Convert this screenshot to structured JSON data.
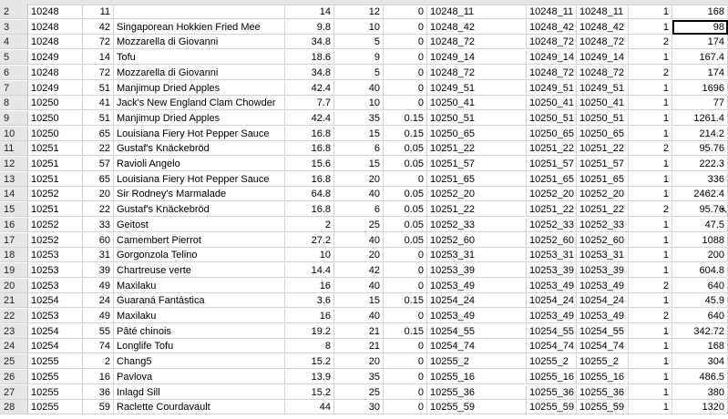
{
  "sheet": {
    "rows": [
      {
        "rownum": "2",
        "c1": "10248",
        "c2": "11",
        "c3": "",
        "c4": "14",
        "c5": "12",
        "c6": "0",
        "c7": "10248_11",
        "c8": "10248_11",
        "c9": "10248_11",
        "c10": "1",
        "c11": "168"
      },
      {
        "rownum": "3",
        "c1": "10248",
        "c2": "42",
        "c3": "Singaporean Hokkien Fried Mee",
        "c4": "9.8",
        "c5": "10",
        "c6": "0",
        "c7": "10248_42",
        "c8": "10248_42",
        "c9": "10248_42",
        "c10": "1",
        "c11": "98"
      },
      {
        "rownum": "4",
        "c1": "10248",
        "c2": "72",
        "c3": "Mozzarella di Giovanni",
        "c4": "34.8",
        "c5": "5",
        "c6": "0",
        "c7": "10248_72",
        "c8": "10248_72",
        "c9": "10248_72",
        "c10": "2",
        "c11": "174"
      },
      {
        "rownum": "5",
        "c1": "10249",
        "c2": "14",
        "c3": "Tofu",
        "c4": "18.6",
        "c5": "9",
        "c6": "0",
        "c7": "10249_14",
        "c8": "10249_14",
        "c9": "10249_14",
        "c10": "1",
        "c11": "167.4"
      },
      {
        "rownum": "6",
        "c1": "10248",
        "c2": "72",
        "c3": "Mozzarella di Giovanni",
        "c4": "34.8",
        "c5": "5",
        "c6": "0",
        "c7": "10248_72",
        "c8": "10248_72",
        "c9": "10248_72",
        "c10": "2",
        "c11": "174"
      },
      {
        "rownum": "7",
        "c1": "10249",
        "c2": "51",
        "c3": "Manjimup Dried Apples",
        "c4": "42.4",
        "c5": "40",
        "c6": "0",
        "c7": "10249_51",
        "c8": "10249_51",
        "c9": "10249_51",
        "c10": "1",
        "c11": "1696"
      },
      {
        "rownum": "8",
        "c1": "10250",
        "c2": "41",
        "c3": "Jack's New England Clam Chowder",
        "c4": "7.7",
        "c5": "10",
        "c6": "0",
        "c7": "10250_41",
        "c8": "10250_41",
        "c9": "10250_41",
        "c10": "1",
        "c11": "77"
      },
      {
        "rownum": "9",
        "c1": "10250",
        "c2": "51",
        "c3": "Manjimup Dried Apples",
        "c4": "42.4",
        "c5": "35",
        "c6": "0.15",
        "c7": "10250_51",
        "c8": "10250_51",
        "c9": "10250_51",
        "c10": "1",
        "c11": "1261.4"
      },
      {
        "rownum": "10",
        "c1": "10250",
        "c2": "65",
        "c3": "Louisiana Fiery Hot Pepper Sauce",
        "c4": "16.8",
        "c5": "15",
        "c6": "0.15",
        "c7": "10250_65",
        "c8": "10250_65",
        "c9": "10250_65",
        "c10": "1",
        "c11": "214.2"
      },
      {
        "rownum": "11",
        "c1": "10251",
        "c2": "22",
        "c3": "Gustaf's Knäckebröd",
        "c4": "16.8",
        "c5": "6",
        "c6": "0.05",
        "c7": "10251_22",
        "c8": "10251_22",
        "c9": "10251_22",
        "c10": "2",
        "c11": "95.76"
      },
      {
        "rownum": "12",
        "c1": "10251",
        "c2": "57",
        "c3": "Ravioli Angelo",
        "c4": "15.6",
        "c5": "15",
        "c6": "0.05",
        "c7": "10251_57",
        "c8": "10251_57",
        "c9": "10251_57",
        "c10": "1",
        "c11": "222.3"
      },
      {
        "rownum": "13",
        "c1": "10251",
        "c2": "65",
        "c3": "Louisiana Fiery Hot Pepper Sauce",
        "c4": "16.8",
        "c5": "20",
        "c6": "0",
        "c7": "10251_65",
        "c8": "10251_65",
        "c9": "10251_65",
        "c10": "1",
        "c11": "336"
      },
      {
        "rownum": "14",
        "c1": "10252",
        "c2": "20",
        "c3": "Sir Rodney's Marmalade",
        "c4": "64.8",
        "c5": "40",
        "c6": "0.05",
        "c7": "10252_20",
        "c8": "10252_20",
        "c9": "10252_20",
        "c10": "1",
        "c11": "2462.4"
      },
      {
        "rownum": "15",
        "c1": "10251",
        "c2": "22",
        "c3": "Gustaf's Knäckebröd",
        "c4": "16.8",
        "c5": "6",
        "c6": "0.05",
        "c7": "10251_22",
        "c8": "10251_22",
        "c9": "10251_22",
        "c10": "2",
        "c11": "95.76"
      },
      {
        "rownum": "16",
        "c1": "10252",
        "c2": "33",
        "c3": "Geitost",
        "c4": "2",
        "c5": "25",
        "c6": "0.05",
        "c7": "10252_33",
        "c8": "10252_33",
        "c9": "10252_33",
        "c10": "1",
        "c11": "47.5"
      },
      {
        "rownum": "17",
        "c1": "10252",
        "c2": "60",
        "c3": "Camembert Pierrot",
        "c4": "27.2",
        "c5": "40",
        "c6": "0.05",
        "c7": "10252_60",
        "c8": "10252_60",
        "c9": "10252_60",
        "c10": "1",
        "c11": "1088"
      },
      {
        "rownum": "18",
        "c1": "10253",
        "c2": "31",
        "c3": "Gorgonzola Telino",
        "c4": "10",
        "c5": "20",
        "c6": "0",
        "c7": "10253_31",
        "c8": "10253_31",
        "c9": "10253_31",
        "c10": "1",
        "c11": "200"
      },
      {
        "rownum": "19",
        "c1": "10253",
        "c2": "39",
        "c3": "Chartreuse verte",
        "c4": "14.4",
        "c5": "42",
        "c6": "0",
        "c7": "10253_39",
        "c8": "10253_39",
        "c9": "10253_39",
        "c10": "1",
        "c11": "604.8"
      },
      {
        "rownum": "20",
        "c1": "10253",
        "c2": "49",
        "c3": "Maxilaku",
        "c4": "16",
        "c5": "40",
        "c6": "0",
        "c7": "10253_49",
        "c8": "10253_49",
        "c9": "10253_49",
        "c10": "2",
        "c11": "640"
      },
      {
        "rownum": "21",
        "c1": "10254",
        "c2": "24",
        "c3": "Guaraná Fantástica",
        "c4": "3.6",
        "c5": "15",
        "c6": "0.15",
        "c7": "10254_24",
        "c8": "10254_24",
        "c9": "10254_24",
        "c10": "1",
        "c11": "45.9"
      },
      {
        "rownum": "22",
        "c1": "10253",
        "c2": "49",
        "c3": "Maxilaku",
        "c4": "16",
        "c5": "40",
        "c6": "0",
        "c7": "10253_49",
        "c8": "10253_49",
        "c9": "10253_49",
        "c10": "2",
        "c11": "640"
      },
      {
        "rownum": "23",
        "c1": "10254",
        "c2": "55",
        "c3": "Pâté chinois",
        "c4": "19.2",
        "c5": "21",
        "c6": "0.15",
        "c7": "10254_55",
        "c8": "10254_55",
        "c9": "10254_55",
        "c10": "1",
        "c11": "342.72"
      },
      {
        "rownum": "24",
        "c1": "10254",
        "c2": "74",
        "c3": "Longlife Tofu",
        "c4": "8",
        "c5": "21",
        "c6": "0",
        "c7": "10254_74",
        "c8": "10254_74",
        "c9": "10254_74",
        "c10": "1",
        "c11": "168"
      },
      {
        "rownum": "25",
        "c1": "10255",
        "c2": "2",
        "c3": "Chang5",
        "c4": "15.2",
        "c5": "20",
        "c6": "0",
        "c7": "10255_2",
        "c8": "10255_2",
        "c9": "10255_2",
        "c10": "1",
        "c11": "304"
      },
      {
        "rownum": "26",
        "c1": "10255",
        "c2": "16",
        "c3": "Pavlova",
        "c4": "13.9",
        "c5": "35",
        "c6": "0",
        "c7": "10255_16",
        "c8": "10255_16",
        "c9": "10255_16",
        "c10": "1",
        "c11": "486.5"
      },
      {
        "rownum": "27",
        "c1": "10255",
        "c2": "36",
        "c3": "Inlagd Sill",
        "c4": "15.2",
        "c5": "25",
        "c6": "0",
        "c7": "10255_36",
        "c8": "10255_36",
        "c9": "10255_36",
        "c10": "1",
        "c11": "380"
      },
      {
        "rownum": "28",
        "c1": "10255",
        "c2": "59",
        "c3": "Raclette Courdavault",
        "c4": "44",
        "c5": "30",
        "c6": "0",
        "c7": "10255_59",
        "c8": "10255_59",
        "c9": "10255_59",
        "c10": "1",
        "c11": "1320"
      }
    ],
    "selected_cell": {
      "row": 1,
      "col": "c11"
    },
    "colors": {
      "gridline": "#d4d4d4",
      "header_bg": "#e6e6e6",
      "selection": "#000000"
    }
  }
}
